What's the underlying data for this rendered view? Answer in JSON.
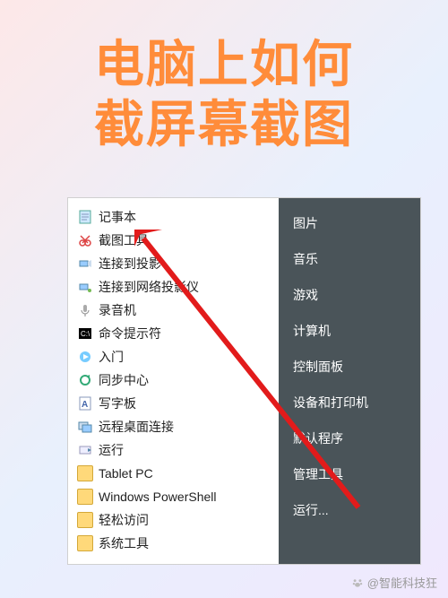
{
  "title": {
    "line1": "电脑上如何",
    "line2": "截屏幕截图"
  },
  "left_menu": [
    {
      "label": "记事本",
      "icon": "notepad"
    },
    {
      "label": "截图工具",
      "icon": "snipping",
      "highlight": true
    },
    {
      "label": "连接到投影",
      "icon": "projector"
    },
    {
      "label": "连接到网络投影仪",
      "icon": "net-projector"
    },
    {
      "label": "录音机",
      "icon": "recorder"
    },
    {
      "label": "命令提示符",
      "icon": "cmd"
    },
    {
      "label": "入门",
      "icon": "getting-started"
    },
    {
      "label": "同步中心",
      "icon": "sync"
    },
    {
      "label": "写字板",
      "icon": "wordpad"
    },
    {
      "label": "远程桌面连接",
      "icon": "rdp"
    },
    {
      "label": "运行",
      "icon": "run"
    },
    {
      "label": "Tablet PC",
      "icon": "folder"
    },
    {
      "label": "Windows PowerShell",
      "icon": "folder"
    },
    {
      "label": "轻松访问",
      "icon": "folder"
    },
    {
      "label": "系统工具",
      "icon": "folder"
    }
  ],
  "right_menu": [
    "图片",
    "音乐",
    "游戏",
    "计算机",
    "控制面板",
    "设备和打印机",
    "默认程序",
    "管理工具",
    "运行..."
  ],
  "attribution": "@智能科技狂"
}
